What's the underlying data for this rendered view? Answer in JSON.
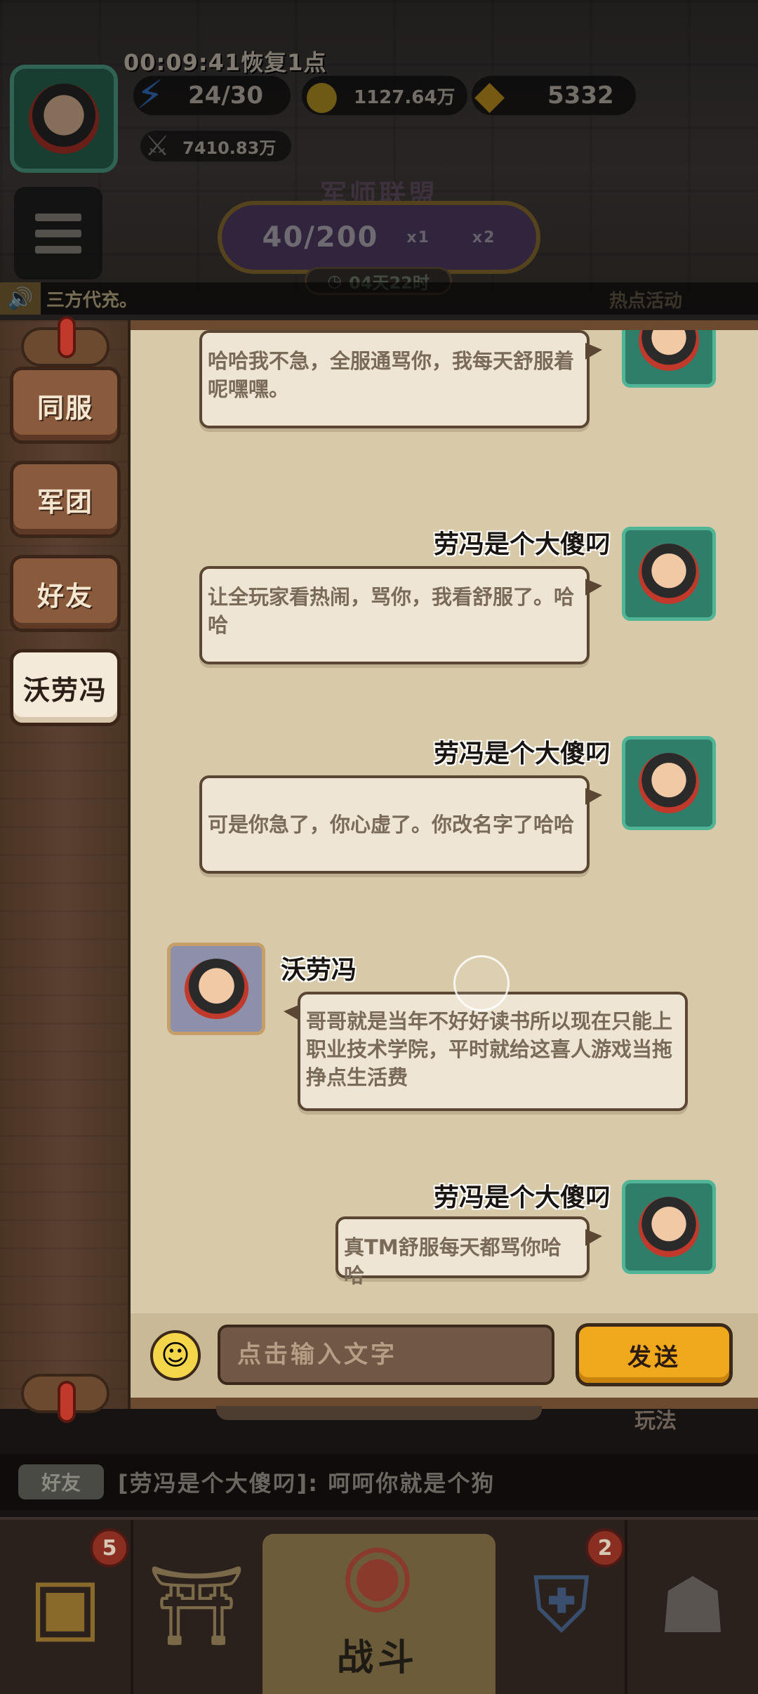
{
  "hud": {
    "timer": "00:09:41恢复1点",
    "energy": "24/30",
    "coins": "1127.64万",
    "gold": "5332",
    "power": "7410.83万"
  },
  "alliance": {
    "title": "军师联盟",
    "progress": "40/200",
    "key1": "x1",
    "key2": "x2",
    "timer": "04天22时"
  },
  "marquee": {
    "text": "三方代充。",
    "hot": "热点活动"
  },
  "tabs": [
    {
      "label": "同服",
      "active": false
    },
    {
      "label": "军团",
      "active": false
    },
    {
      "label": "好友",
      "active": false
    },
    {
      "label": "沃劳冯",
      "active": true
    }
  ],
  "messages": [
    {
      "sender": "",
      "side": "right",
      "text": "哈哈我不急，全服通骂你，我每天舒服着呢嘿嘿。"
    },
    {
      "sender": "劳冯是个大傻叼",
      "side": "right",
      "text": "让全玩家看热闹，骂你，我看舒服了。哈哈"
    },
    {
      "sender": "劳冯是个大傻叼",
      "side": "right",
      "text": "可是你急了，你心虚了。你改名字了哈哈"
    },
    {
      "sender": "沃劳冯",
      "side": "left",
      "text": "哥哥就是当年不好好读书所以现在只能上职业技术学院，平时就给这喜人游戏当拖挣点生活费"
    },
    {
      "sender": "劳冯是个大傻叼",
      "side": "right",
      "text": "真TM舒服每天都骂你哈哈"
    }
  ],
  "input": {
    "placeholder": "点击输入文字",
    "send_label": "发送"
  },
  "bottom": {
    "wanfa": "玩法",
    "news_tag": "好友",
    "news_text": "[劳冯是个大傻叼]: 呵呵你就是个狗",
    "battle_label": "战斗",
    "badge_chest": "5",
    "badge_armor": "2"
  },
  "colors": {
    "panel_bg": "#d8c9a8",
    "bubble_bg": "#efe5d4",
    "send_button": "#f0a81c",
    "tab_active": "#f3ead9",
    "tab_inactive": "#8a5a3c"
  }
}
